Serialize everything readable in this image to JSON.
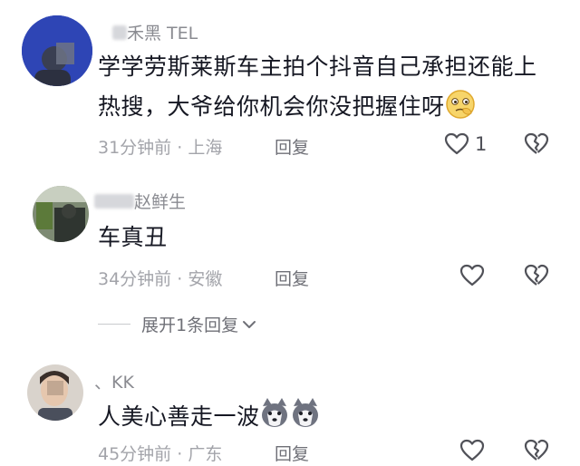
{
  "comments": [
    {
      "username": "禾黑 TEL",
      "text": "学学劳斯莱斯车主拍个抖音自己承担还能上热搜，大爷给你机会你没把握住呀",
      "emoji": "thinking-face-icon",
      "time": "31分钟前",
      "location": "上海",
      "reply_label": "回复",
      "like_count": "1"
    },
    {
      "username": "赵鲜生",
      "text": "车真丑",
      "time": "34分钟前",
      "location": "安徽",
      "reply_label": "回复",
      "like_count": "",
      "expand_label": "展开1条回复"
    },
    {
      "username": "、KK",
      "text": "人美心善走一波",
      "emoji": "husky-dog-icon",
      "time": "45分钟前",
      "location": "广东",
      "reply_label": "回复",
      "like_count": ""
    }
  ],
  "colors": {
    "primary_text": "#161823",
    "secondary_text": "#a3a4aa",
    "icon": "#505158"
  }
}
